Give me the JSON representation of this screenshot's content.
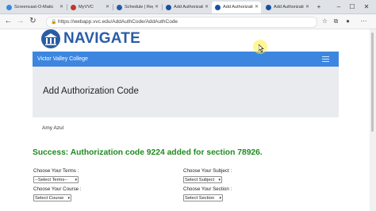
{
  "browser": {
    "tabs": [
      {
        "label": "Screencast-O-Matic",
        "active": false,
        "favicon_color": "#3c86e0"
      },
      {
        "label": "MyVVC",
        "active": false,
        "favicon_color": "#c0392b"
      },
      {
        "label": "Schedule | Regist",
        "active": false,
        "favicon_color": "#2a5ca6"
      },
      {
        "label": "Add Authorization",
        "active": false,
        "favicon_color": "#1b4fa0"
      },
      {
        "label": "Add Authorization",
        "active": true,
        "favicon_color": "#1b4fa0"
      },
      {
        "label": "Add Authorization",
        "active": false,
        "favicon_color": "#1b4fa0"
      }
    ],
    "url": "https://webapp.vvc.edu/AddAuthCode/AddAuthCode"
  },
  "site": {
    "logo": "NAVIGATE",
    "college": "Victor Valley College"
  },
  "page": {
    "title": "Add Authorization Code",
    "user": "Amy Azul",
    "success_message": "Success: Authorization code 9224 added for section 78926."
  },
  "form": {
    "term_label": "Choose Your Terms :",
    "term_value": "--Select Terms--",
    "subject_label": "Choose Your Subject :",
    "subject_value": "Select Subject",
    "course_label": "Choose Your Course :",
    "course_value": "Select Course",
    "section_label": "Choose Your Section :",
    "section_value": "Select Section"
  },
  "colors": {
    "brand": "#2a5ca6",
    "nav_bar": "#3c86e0",
    "success": "#1f8a1f"
  }
}
